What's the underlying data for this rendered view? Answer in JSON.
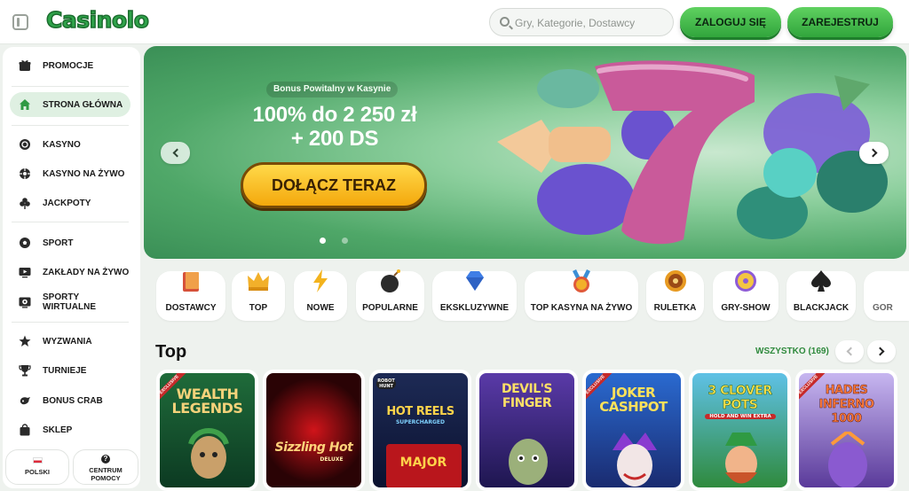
{
  "header": {
    "logo": "Casinolo",
    "search_placeholder": "Gry, Kategorie, Dostawcy",
    "login_label": "ZALOGUJ SIĘ",
    "register_label": "ZAREJESTRUJ"
  },
  "sidebar": {
    "items": [
      {
        "label": "PROMOCJE",
        "icon": "gift-icon",
        "active": false
      },
      {
        "label": "STRONA GŁÓWNA",
        "icon": "home-icon",
        "active": true
      },
      {
        "label": "KASYNO",
        "icon": "casino-chip-icon",
        "active": false
      },
      {
        "label": "KASYNO NA ŻYWO",
        "icon": "roulette-icon",
        "active": false
      },
      {
        "label": "JACKPOTY",
        "icon": "clover-icon",
        "active": false
      },
      {
        "label": "SPORT",
        "icon": "football-icon",
        "active": false
      },
      {
        "label": "ZAKŁADY NA ŻYWO",
        "icon": "live-tv-icon",
        "active": false
      },
      {
        "label": "SPORTY WIRTUALNE",
        "icon": "virtual-sports-icon",
        "active": false
      },
      {
        "label": "WYZWANIA",
        "icon": "star-badge-icon",
        "active": false
      },
      {
        "label": "TURNIEJE",
        "icon": "trophy-icon",
        "active": false
      },
      {
        "label": "BONUS CRAB",
        "icon": "crab-icon",
        "active": false
      },
      {
        "label": "SKLEP",
        "icon": "shopping-bag-icon",
        "active": false
      }
    ],
    "footer": {
      "language": "POLSKI",
      "help": "CENTRUM POMOCY"
    }
  },
  "hero": {
    "badge": "Bonus Powitalny w Kasynie",
    "title_line1": "100% do 2 250 zł",
    "title_line2": "+ 200 DS",
    "cta": "DOŁĄCZ TERAZ",
    "slide_count": 2,
    "active_slide": 1
  },
  "categories": [
    {
      "label": "DOSTAWCY",
      "icon": "book-icon",
      "color": "#d6513a"
    },
    {
      "label": "TOP",
      "icon": "crown-icon",
      "color": "#f2b02a"
    },
    {
      "label": "NOWE",
      "icon": "lightning-icon",
      "color": "#f3b31d"
    },
    {
      "label": "POPULARNE",
      "icon": "bomb-icon",
      "color": "#2b2b2b"
    },
    {
      "label": "EKSKLUZYWNE",
      "icon": "diamond-icon",
      "color": "#3f7ee6"
    },
    {
      "label": "TOP KASYNA NA ŻYWO",
      "icon": "medal-icon",
      "color": "#e05a3a"
    },
    {
      "label": "RULETKA",
      "icon": "roulette-wheel-icon",
      "color": "#e79a22"
    },
    {
      "label": "GRY-SHOW",
      "icon": "wheel-icon",
      "color": "#8e5bd6"
    },
    {
      "label": "BLACKJACK",
      "icon": "spade-icon",
      "color": "#222222"
    },
    {
      "label": "GOR",
      "icon": "more-icon",
      "color": "#888888"
    }
  ],
  "top_section": {
    "title": "Top",
    "see_all": "WSZYSTKO (169)"
  },
  "games": [
    {
      "title": "WEALTH LEGENDS",
      "exclusive": "EXCLUSIVE",
      "bg1": "#1f6b3a",
      "bg2": "#0c3a22",
      "fg": "#f4d27a"
    },
    {
      "title": "Sizzling Hot",
      "sub": "DELUXE",
      "bg1": "#9e0f12",
      "bg2": "#2a0305",
      "fg": "#ffd27a"
    },
    {
      "title": "HOT REELS",
      "sub": "SUPERCHARGED",
      "badge": "ROBOT HUNT",
      "bg1": "#1d2a55",
      "bg2": "#0b1230",
      "fg": "#ffd34a"
    },
    {
      "title": "DEVIL'S FINGER",
      "bg1": "#5a3aa8",
      "bg2": "#1e1650",
      "fg": "#ffe066"
    },
    {
      "title": "JOKER CASHPOT",
      "exclusive": "EXCLUSIVE",
      "bg1": "#2a6ad0",
      "bg2": "#1a2b70",
      "fg": "#ffe15a"
    },
    {
      "title": "3 CLOVER POTS",
      "sub": "HOLD AND WIN EXTRA",
      "bg1": "#5fc1e6",
      "bg2": "#2f8a3d",
      "fg": "#ffe24a"
    },
    {
      "title": "HADES INFERNO 1000",
      "exclusive": "EXCLUSIVE",
      "bg1": "#c7b6f0",
      "bg2": "#5a3a9a",
      "fg": "#ff7a3a"
    }
  ]
}
